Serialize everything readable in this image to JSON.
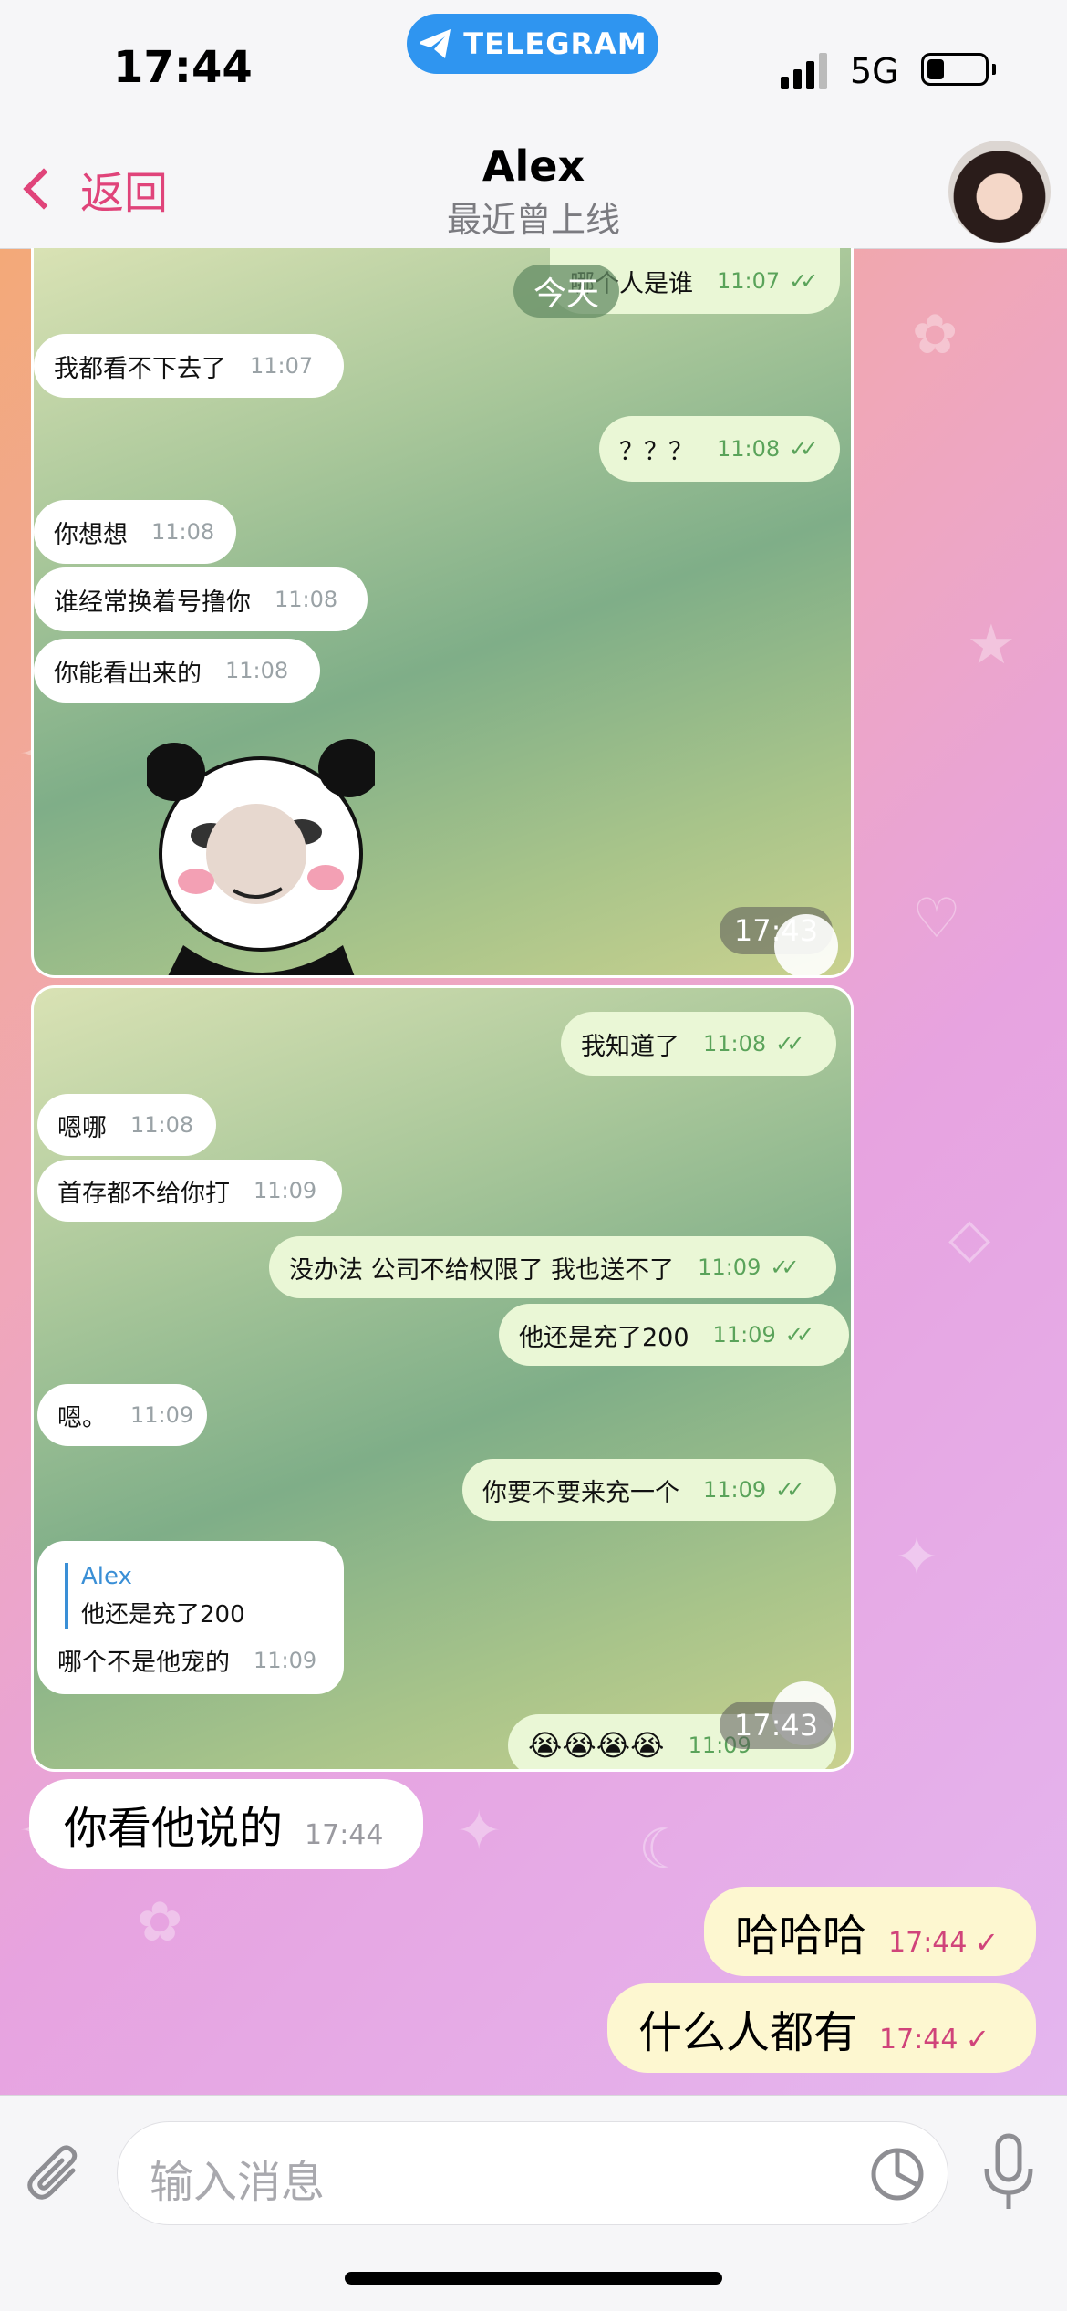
{
  "status_bar": {
    "time": "17:44",
    "app_pill": "TELEGRAM",
    "network": "5G"
  },
  "nav": {
    "back_label": "返回",
    "contact_name": "Alex",
    "contact_status": "最近曾上线"
  },
  "screenshot1": {
    "date_pill": "今天",
    "messages": [
      {
        "dir": "out",
        "text": "哪个人是谁",
        "time": "11:07",
        "read": true
      },
      {
        "dir": "in",
        "text": "我都看不下去了",
        "time": "11:07"
      },
      {
        "dir": "out",
        "text": "？？？",
        "time": "11:08",
        "read": true
      },
      {
        "dir": "in",
        "text": "你想想",
        "time": "11:08"
      },
      {
        "dir": "in",
        "text": "谁经常换着号撸你",
        "time": "11:08"
      },
      {
        "dir": "in",
        "text": "你能看出来的",
        "time": "11:08"
      }
    ],
    "sticker": "panda-meme",
    "image_time": "17:43"
  },
  "screenshot2": {
    "messages": [
      {
        "dir": "out",
        "text": "我知道了",
        "time": "11:08",
        "read": true
      },
      {
        "dir": "in",
        "text": "嗯哪",
        "time": "11:08"
      },
      {
        "dir": "in",
        "text": "首存都不给你打",
        "time": "11:09"
      },
      {
        "dir": "out",
        "text": "没办法  公司不给权限了 我也送不了",
        "time": "11:09",
        "read": true
      },
      {
        "dir": "out",
        "text": "他还是充了200",
        "time": "11:09",
        "read": true
      },
      {
        "dir": "in",
        "text": "嗯。",
        "time": "11:09"
      },
      {
        "dir": "out",
        "text": "你要不要来充一个",
        "time": "11:09",
        "read": true
      },
      {
        "dir": "in",
        "text": "哪个不是他宠的",
        "time": "11:09",
        "reply_name": "Alex",
        "reply_text": "他还是充了200"
      },
      {
        "dir": "out",
        "text": "😭😭😭😭",
        "time": "11:09"
      }
    ],
    "image_time": "17:43"
  },
  "messages": [
    {
      "dir": "in",
      "text": "你看他说的",
      "time": "17:44"
    },
    {
      "dir": "out",
      "text": "哈哈哈",
      "time": "17:44",
      "check": "✓"
    },
    {
      "dir": "out",
      "text": "什么人都有",
      "time": "17:44",
      "check": "✓"
    }
  ],
  "input": {
    "placeholder": "输入消息"
  },
  "icons": {
    "attach": "paperclip-icon",
    "sticker": "sticker-icon",
    "mic": "microphone-icon"
  },
  "colors": {
    "accent": "#e0447a",
    "telegram_blue": "#2f95f0",
    "out_bubble": "#fdf7d0"
  }
}
